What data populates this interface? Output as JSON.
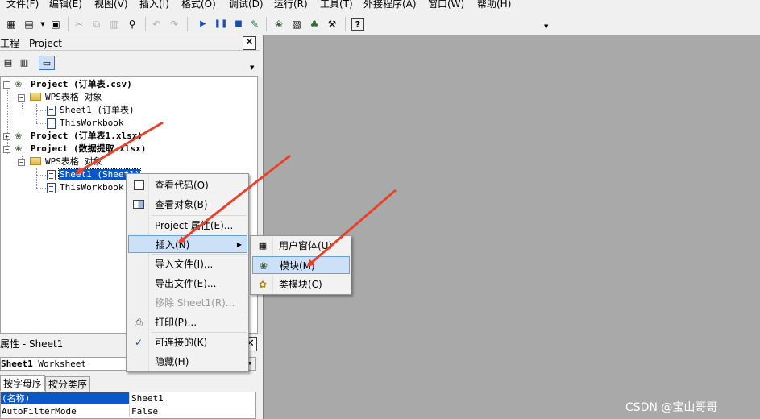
{
  "menubar": {
    "items": [
      "文件(F)",
      "编辑(E)",
      "视图(V)",
      "插入(I)",
      "格式(O)",
      "调试(D)",
      "运行(R)",
      "工具(T)",
      "外接程序(A)",
      "窗口(W)",
      "帮助(H)"
    ]
  },
  "project": {
    "title": "工程 - Project",
    "tree": {
      "p1": "Project (订单表.csv)",
      "p1_folder": "WPS表格 对象",
      "p1_sheet": "Sheet1 (订单表)",
      "p1_wb": "ThisWorkbook",
      "p2": "Project (订单表1.xlsx)",
      "p3": "Project (数据提取.xlsx)",
      "p3_folder": "WPS表格 对象",
      "p3_sheet": "Sheet1 (Sheet1)",
      "p3_wb": "ThisWorkbook"
    }
  },
  "properties": {
    "title": "属性 - Sheet1",
    "object_name": "Sheet1",
    "object_type": "Worksheet",
    "tab_alpha": "按字母序",
    "tab_category": "按分类序",
    "rows": [
      {
        "key": "(名称)",
        "value": "Sheet1"
      },
      {
        "key": "AutoFilterMode",
        "value": "False"
      }
    ]
  },
  "context_menu": {
    "view_code": "查看代码(O)",
    "view_object": "查看对象(B)",
    "project_props": "Project 属性(E)...",
    "insert": "插入(N)",
    "import_file": "导入文件(I)...",
    "export_file": "导出文件(E)...",
    "remove": "移除 Sheet1(R)...",
    "print": "打印(P)...",
    "dockable": "可连接的(K)",
    "hide": "隐藏(H)"
  },
  "submenu": {
    "userform": "用户窗体(U)",
    "module": "模块(M)",
    "class_module": "类模块(C)"
  },
  "annotation_color": "#e8432a",
  "watermark": "CSDN @宝山哥哥"
}
